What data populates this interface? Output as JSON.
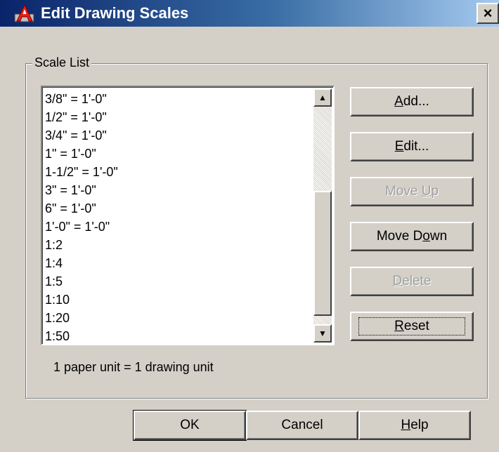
{
  "window": {
    "title": "Edit Drawing Scales",
    "close_label": "×",
    "colors": {
      "titlebar_start": "#0a246a",
      "titlebar_end": "#a6caf0",
      "face": "#d4d0c8"
    },
    "app_icon": "autocad-app-icon"
  },
  "scale_list": {
    "group_label": "Scale List",
    "items": [
      "3/8\" = 1'-0\"",
      "1/2\" = 1'-0\"",
      "3/4\" = 1'-0\"",
      "1\" = 1'-0\"",
      "1-1/2\" = 1'-0\"",
      "3\" = 1'-0\"",
      "6\" = 1'-0\"",
      "1'-0\" = 1'-0\"",
      "1:2",
      "1:4",
      "1:5",
      "1:10",
      "1:20",
      "1:50"
    ],
    "scroll_up_icon": "▲",
    "scroll_down_icon": "▼",
    "info_text": "1 paper unit = 1 drawing unit"
  },
  "side_buttons": {
    "add": {
      "pre": "",
      "key": "A",
      "post": "dd...",
      "enabled": true
    },
    "edit": {
      "pre": "",
      "key": "E",
      "post": "dit...",
      "enabled": true
    },
    "move_up": {
      "pre": "Move ",
      "key": "U",
      "post": "p",
      "enabled": false
    },
    "move_down": {
      "pre": "Move D",
      "key": "o",
      "post": "wn",
      "enabled": true
    },
    "delete": {
      "pre": "",
      "key": "D",
      "post": "elete",
      "enabled": false
    },
    "reset": {
      "pre": "",
      "key": "R",
      "post": "eset",
      "enabled": true
    }
  },
  "footer_buttons": {
    "ok": "OK",
    "cancel": "Cancel",
    "help": {
      "pre": "",
      "key": "H",
      "post": "elp"
    }
  }
}
